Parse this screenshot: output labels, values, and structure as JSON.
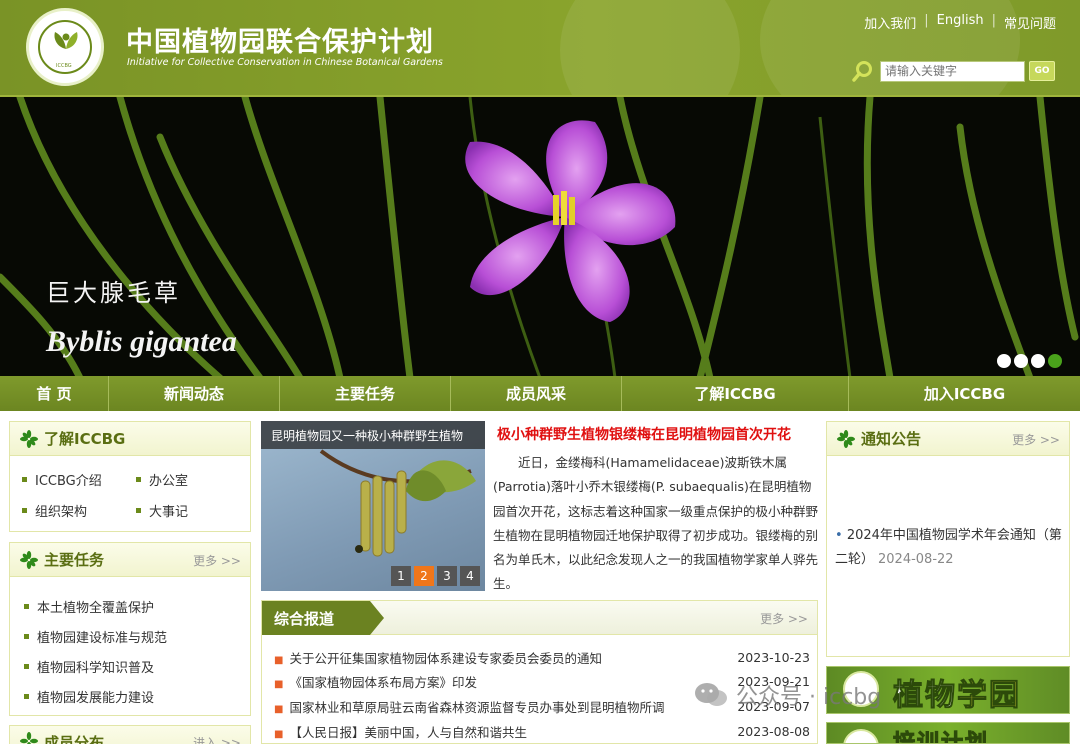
{
  "header": {
    "title": "中国植物园联合保护计划",
    "subtitle": "Initiative for Collective Conservation in Chinese Botanical Gardens",
    "logo_text": "ICCBG",
    "top_links": [
      "加入我们",
      "English",
      "常见问题"
    ],
    "search_placeholder": "请输入关键字",
    "go_label": "GO"
  },
  "banner": {
    "title_cn": "巨大腺毛草",
    "title_latin": "Byblis gigantea",
    "dots": 4,
    "active_dot": 4
  },
  "nav": [
    {
      "label": "首 页",
      "width": 109
    },
    {
      "label": "新闻动态",
      "width": 171
    },
    {
      "label": "主要任务",
      "width": 171
    },
    {
      "label": "成员风采",
      "width": 171
    },
    {
      "label": "了解ICCBG",
      "width": 227
    },
    {
      "label": "加入ICCBG",
      "width": 231
    }
  ],
  "about": {
    "title": "了解ICCBG",
    "items": [
      "ICCBG介绍",
      "办公室",
      "组织架构",
      "大事记"
    ]
  },
  "tasks": {
    "title": "主要任务",
    "more": "更多 >>",
    "items": [
      "本土植物全覆盖保护",
      "植物园建设标准与规范",
      "植物园科学知识普及",
      "植物园发展能力建设"
    ]
  },
  "members": {
    "title": "成员分布",
    "more": "进入 >>"
  },
  "slideshow": {
    "caption": "昆明植物园又一种极小种群野生植物",
    "pages": [
      "1",
      "2",
      "3",
      "4"
    ],
    "active": "2"
  },
  "headline": {
    "title": "极小种群野生植物银缕梅在昆明植物园首次开花",
    "summary": "近日，金缕梅科(Hamamelidaceae)波斯铁木属(Parrotia)落叶小乔木银缕梅(P. subaequalis)在昆明植物园首次开花，这标志着这种国家一级重点保护的极小种群野生植物在昆明植物园迁地保护取得了初步成功。银缕梅的别名为单氏木，以此纪念发现人之一的我国植物学家单人骅先生。"
  },
  "news": {
    "title": "综合报道",
    "more": "更多 >>",
    "items": [
      {
        "title": "关于公开征集国家植物园体系建设专家委员会委员的通知",
        "date": "2023-10-23"
      },
      {
        "title": "《国家植物园体系布局方案》印发",
        "date": "2023-09-21"
      },
      {
        "title": "国家林业和草原局驻云南省森林资源监督专员办事处到昆明植物所调",
        "date": "2023-09-07"
      },
      {
        "title": "【人民日报】美丽中国，人与自然和谐共生",
        "date": "2023-08-08"
      }
    ]
  },
  "notice": {
    "title": "通知公告",
    "more": "更多 >>",
    "items": [
      {
        "title": "2024年中国植物园学术年会通知（第二轮）",
        "date": "2024-08-22"
      }
    ]
  },
  "side_banners": {
    "garden_a": "植物",
    "garden_b": "学园",
    "training": "培训计划"
  },
  "watermark": "公众号 · iccbg"
}
